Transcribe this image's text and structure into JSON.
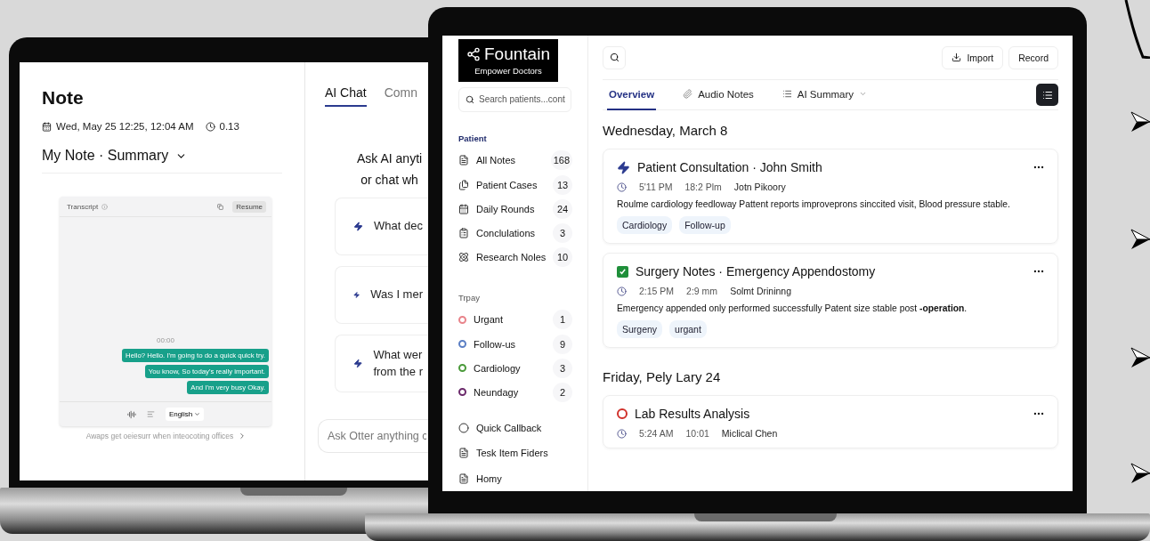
{
  "left_screen": {
    "note": {
      "title": "Note",
      "date": "Wed, May 25 12:25, 12:04 AM",
      "duration": "0.13",
      "summary_title": "My Note · Summary",
      "transcript": {
        "title": "Transcript",
        "resume": "Resume",
        "timestamp": "00:00",
        "messages": [
          "Hello? Hello. I'm going to do a quick quick try.",
          "You know, So today's really important.",
          "And I'm very busy Okay."
        ],
        "language": "English"
      },
      "caption": "Awaps get oeiesurr when inteocoting offices"
    },
    "chat": {
      "tabs": [
        {
          "label": "AI Chat",
          "selected": true
        },
        {
          "label": "Comn",
          "selected": false
        }
      ],
      "prompt_lines": [
        "Ask AI anyti",
        "or chat wh"
      ],
      "suggestions": [
        [
          "What dec"
        ],
        [
          "Was I mer"
        ],
        [
          "What wer",
          "from the r"
        ]
      ],
      "input": {
        "placeholder": "Ask Otter anything c"
      }
    }
  },
  "right_screen": {
    "brand": {
      "name": "Fountain",
      "tagline": "Empower Doctors"
    },
    "search": {
      "placeholder": "Search patients...cont"
    },
    "sections": [
      {
        "title": "Patient",
        "items": [
          {
            "label": "All Notes",
            "count": "168"
          },
          {
            "label": "Patient Cases",
            "count": "13"
          },
          {
            "label": "Daily Rounds",
            "count": "24"
          },
          {
            "label": "Conclulations",
            "count": "3"
          },
          {
            "label": "Research Noles",
            "count": "10"
          }
        ]
      },
      {
        "title": "Trpay",
        "items": [
          {
            "label": "Urgant",
            "count": "1",
            "color": "#e8838a"
          },
          {
            "label": "Follow-us",
            "count": "9",
            "color": "#5b7fc4"
          },
          {
            "label": "Cardiology",
            "count": "3",
            "color": "#4a9a3a"
          },
          {
            "label": "Neundagy",
            "count": "2",
            "color": "#6b2a6b"
          }
        ]
      }
    ],
    "links": [
      "Quick Callback",
      "Tesk Item Fiders",
      "Homy"
    ],
    "toolbar": {
      "buttons": [
        "Import",
        "Record"
      ]
    },
    "tabs": [
      {
        "label": "Overview",
        "selected": true
      },
      {
        "label": "Audio Notes",
        "selected": false
      },
      {
        "label": "AI Summary",
        "selected": false
      }
    ],
    "days": [
      {
        "date": "Wednesday, March 8",
        "notes": [
          {
            "kind": "ai",
            "title": "Patient Consultation · John Smith",
            "time": "5'11 PM",
            "duration": "18:2 Plm",
            "author": "Jotn Pikoory",
            "summary": "Roulme cardiology feedloway Pattent reports improveprons  sinccited visit,  Blood pressure stable.",
            "tags": [
              "Cardiology",
              "Follow-up"
            ]
          },
          {
            "kind": "done",
            "title": "Surgery Notes · Emergency Appendostomy",
            "time": "2:15 PM",
            "duration": "2:9 mm",
            "author": "Solmt Drininng",
            "summary": "Emergency appended only performed successfully Patent size stable post **-operation**.",
            "tags": [
              "Surgeny",
              "urgant"
            ]
          }
        ]
      },
      {
        "date": "Friday, Pely Lary 24",
        "notes": [
          {
            "kind": "alert",
            "title": "Lab Results Analysis",
            "time": "5:24 AM",
            "duration": "10:01",
            "author": "Miclical Chen"
          }
        ]
      }
    ]
  }
}
